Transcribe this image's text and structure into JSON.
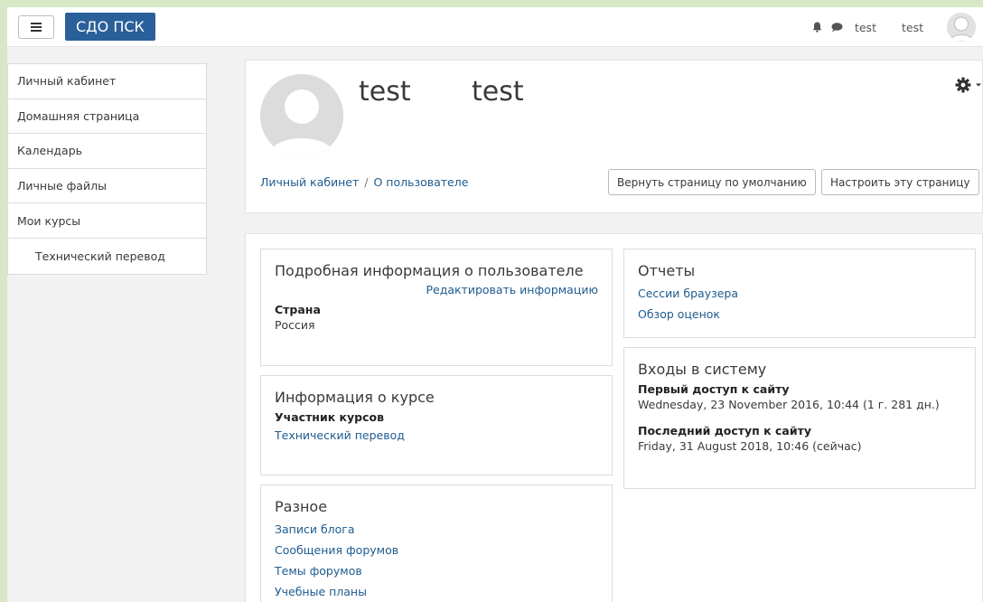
{
  "navbar": {
    "brand": "СДО ПСК",
    "user_first": "test",
    "user_last": "test"
  },
  "sidebar": {
    "items": [
      {
        "label": "Личный кабинет"
      },
      {
        "label": "Домашняя страница"
      },
      {
        "label": "Календарь"
      },
      {
        "label": "Личные файлы"
      },
      {
        "label": "Мои курсы"
      },
      {
        "label": "Технический перевод"
      }
    ]
  },
  "header": {
    "first_name": "test",
    "last_name": "test",
    "breadcrumb": [
      "Личный кабинет",
      "О пользователе"
    ],
    "breadcrumb_sep": "/",
    "reset_button": "Вернуть страницу по умолчанию",
    "customize_button": "Настроить эту страницу"
  },
  "details": {
    "title": "Подробная информация о пользователе",
    "edit_link": "Редактировать информацию",
    "country_label": "Страна",
    "country_value": "Россия"
  },
  "course_info": {
    "title": "Информация о курсе",
    "participant_label": "Участник курсов",
    "course_link": "Технический перевод"
  },
  "misc": {
    "title": "Разное",
    "links": [
      "Записи блога",
      "Сообщения форумов",
      "Темы форумов",
      "Учебные планы"
    ]
  },
  "reports": {
    "title": "Отчеты",
    "links": [
      "Сессии браузера",
      "Обзор оценок"
    ]
  },
  "logins": {
    "title": "Входы в систему",
    "first_label": "Первый доступ к сайту",
    "first_value": "Wednesday, 23 November 2016, 10:44  (1 г. 281 дн.)",
    "last_label": "Последний доступ к сайту",
    "last_value": "Friday, 31 August 2018, 10:46  (сейчас)"
  },
  "colors": {
    "outer_bg": "#d7e8c6",
    "page_bg": "#f2f2f2",
    "brand": "#2a6099",
    "link": "#1e5b8f"
  },
  "icons": {
    "menu": "hamburger-icon",
    "notifications": "bell-icon",
    "messages": "chat-bubble-icon",
    "settings": "gear-icon",
    "dropdown": "caret-down-icon",
    "avatar": "user-avatar-icon"
  }
}
